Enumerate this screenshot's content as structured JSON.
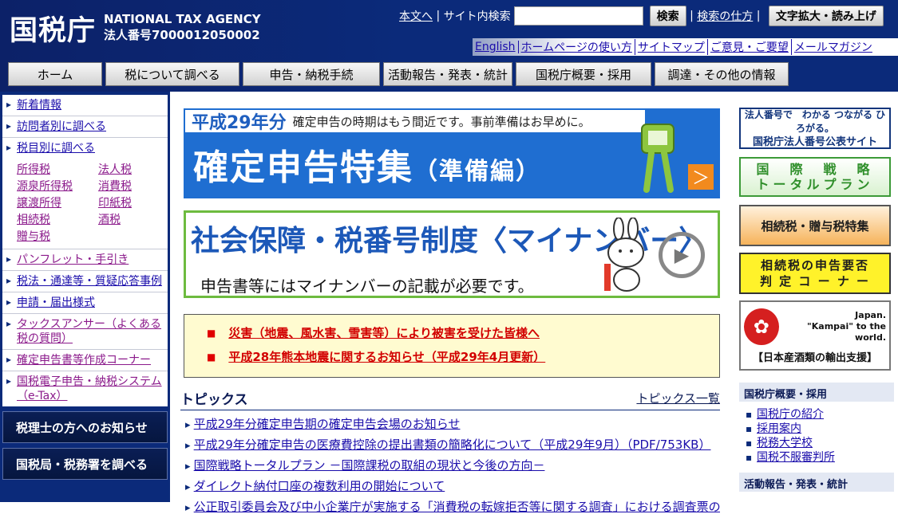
{
  "header": {
    "logo": "国税庁",
    "agency_en": "NATIONAL TAX AGENCY",
    "corp_no": "法人番号7000012050002",
    "skip_link": "本文へ",
    "search_label": "サイト内検索",
    "search_value": "",
    "search_button": "検索",
    "search_help": "検索の仕方",
    "text_size_button": "文字拡大・読み上げ",
    "sublinks": [
      "English",
      "ホームページの使い方",
      "サイトマップ",
      "ご意見・ご要望",
      "メールマガジン"
    ]
  },
  "global_nav": [
    "ホーム",
    "税について調べる",
    "申告・納税手続",
    "活動報告・発表・統計",
    "国税庁概要・採用",
    "調達・その他の情報"
  ],
  "sidebar": {
    "items_top": [
      "新着情報",
      "訪問者別に調べる",
      "税目別に調べる"
    ],
    "tax_types": [
      "所得税",
      "法人税",
      "源泉所得税",
      "消費税",
      "譲渡所得",
      "印紙税",
      "相続税",
      "酒税",
      "贈与税"
    ],
    "items_bottom": [
      "パンフレット・手引き",
      "税法・通達等・質疑応答事例",
      "申請・届出様式",
      "タックスアンサー（よくある税の質問）",
      "確定申告書等作成コーナー",
      "国税電子申告・納税システム（e-Tax）"
    ],
    "buttons": [
      "税理士の方へのお知らせ",
      "国税局・税務署を調べる"
    ]
  },
  "banner1": {
    "year": "平成29年分",
    "message": "確定申告の時期はもう間近です。事前準備はお早めに。",
    "title": "確定申告特集",
    "sub": "（準備編）",
    "arrow": "＞"
  },
  "banner2": {
    "title": "社会保障・税番号制度〈マイナンバー〉",
    "sub": "申告書等にはマイナンバーの記載が必要です。"
  },
  "alerts": [
    "災害（地震、風水害、雪害等）により被害を受けた皆様へ",
    "平成28年熊本地震に関するお知らせ（平成29年4月更新）"
  ],
  "alert_marker": "■",
  "topics": {
    "heading": "トピックス",
    "all_link": "トピックス一覧",
    "items": [
      "平成29年分確定申告期の確定申告会場のお知らせ",
      "平成29年分確定申告の医療費控除の提出書類の簡略化について（平成29年9月）（PDF/753KB）",
      "国際戦略トータルプラン －国際課税の取組の現状と今後の方向－",
      "ダイレクト納付口座の複数利用の開始について",
      "公正取引委員会及び中小企業庁が実施する「消費税の転嫁拒否等に関する調査」における調査票の"
    ]
  },
  "right": {
    "rb1_line1": "法人番号で　わかる つながる ひろがる。",
    "rb1_line2": "国税庁法人番号公表サイト",
    "rb2_line1": "国　際　戦　略",
    "rb2_line2": "トータルプラン",
    "rb3": "相続税・贈与税特集",
    "rb4_line1": "相続税の申告要否",
    "rb4_line2": "判 定 コ ー ナ ー",
    "rb5_jp1": "Japan.",
    "rb5_jp2": "\"Kampai\" to the world.",
    "rb5_caption": "【日本産酒類の輸出支援】",
    "section1": "国税庁概要・採用",
    "section1_items": [
      "国税庁の紹介",
      "採用案内",
      "税務大学校",
      "国税不服審判所"
    ],
    "section2": "活動報告・発表・統計"
  }
}
